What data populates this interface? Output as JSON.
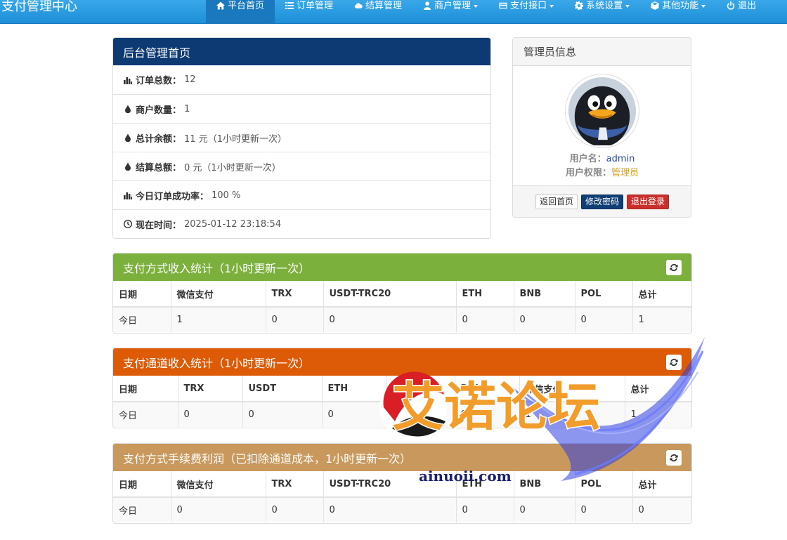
{
  "brand": "支付管理中心",
  "nav": [
    {
      "label": "平台首页",
      "icon": "home-icon",
      "active": true
    },
    {
      "label": "订单管理",
      "icon": "list-icon"
    },
    {
      "label": "结算管理",
      "icon": "cloud-icon"
    },
    {
      "label": "商户管理",
      "icon": "user-icon",
      "dropdown": true
    },
    {
      "label": "支付接口",
      "icon": "credit-card-icon",
      "dropdown": true
    },
    {
      "label": "系统设置",
      "icon": "gear-icon",
      "dropdown": true
    },
    {
      "label": "其他功能",
      "icon": "box-icon",
      "dropdown": true
    },
    {
      "label": "退出",
      "icon": "power-icon"
    }
  ],
  "home": {
    "title": "后台管理首页",
    "rows": [
      {
        "icon": "bar-chart-icon",
        "label": "订单总数：",
        "value": "12"
      },
      {
        "icon": "drop-icon",
        "label": "商户数量：",
        "value": "1"
      },
      {
        "icon": "drop-icon",
        "label": "总计余额：",
        "value": "11 元（1小时更新一次）"
      },
      {
        "icon": "drop-icon",
        "label": "结算总额：",
        "value": "0 元（1小时更新一次）"
      },
      {
        "icon": "bar-chart-icon",
        "label": "今日订单成功率：",
        "value": "100 %"
      },
      {
        "icon": "clock-icon",
        "label": "现在时间：",
        "value": " 2025-01-12 23:18:54"
      }
    ]
  },
  "admin": {
    "title": "管理员信息",
    "username_label": "用户名：",
    "username": "admin",
    "role_label": "用户权限：",
    "role": "管理员",
    "buttons": {
      "home": "返回首页",
      "password": "修改密码",
      "logout": "退出登录"
    }
  },
  "tables": [
    {
      "title": "支付方式收入统计（1小时更新一次）",
      "color": "#7ab03b",
      "headers": [
        "日期",
        "微信支付",
        "TRX",
        "USDT-TRC20",
        "ETH",
        "BNB",
        "POL",
        "总计"
      ],
      "rows": [
        [
          "今日",
          "1",
          "0",
          "0",
          "0",
          "0",
          "0",
          "1"
        ]
      ]
    },
    {
      "title": "支付通道收入统计（1小时更新一次）",
      "color": "#dd5a06",
      "headers": [
        "日期",
        "TRX",
        "USDT",
        "ETH",
        "BNB",
        "POL",
        "微信支付",
        "总计"
      ],
      "rows": [
        [
          "今日",
          "0",
          "0",
          "0",
          "0",
          "0",
          "1",
          "1"
        ]
      ]
    },
    {
      "title": "支付方式手续费利润（已扣除通道成本，1小时更新一次）",
      "color": "#c9985c",
      "headers": [
        "日期",
        "微信支付",
        "TRX",
        "USDT-TRC20",
        "ETH",
        "BNB",
        "POL",
        "总计"
      ],
      "rows": [
        [
          "今日",
          "0",
          "0",
          "0",
          "0",
          "0",
          "0",
          "0"
        ]
      ]
    }
  ],
  "watermark": {
    "title": "艾诺论坛",
    "url": "ainuoii.com"
  },
  "colors": {
    "navbar": "#2a9be2",
    "home_header": "#0d3a73"
  }
}
